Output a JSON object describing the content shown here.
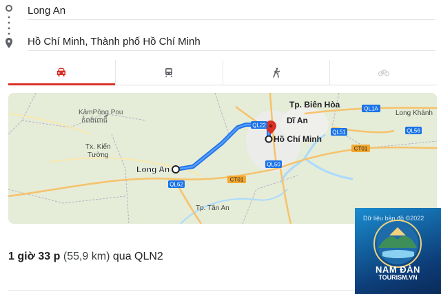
{
  "route": {
    "origin": "Long An",
    "destination": "Hồ Chí Minh, Thành phố Hồ Chí Minh",
    "origin_icon": "origin-circle-icon",
    "destination_icon": "destination-pin-icon"
  },
  "tabs": [
    {
      "name": "driving",
      "icon": "car-icon",
      "active": true
    },
    {
      "name": "transit",
      "icon": "train-icon",
      "active": false
    },
    {
      "name": "walking",
      "icon": "walking-icon",
      "active": false
    },
    {
      "name": "cycling",
      "icon": "bicycle-icon",
      "active": false
    }
  ],
  "map": {
    "labels": {
      "kampong": "KâmPông Pou",
      "kampong_khmer": "កំពង់ពោធិ៍",
      "tx_kien": "Tx. Kiến",
      "tuong": "Tường",
      "long_an": "Long An",
      "bien_hoa": "Tp. Biên Hòa",
      "di_an": "Dĩ An",
      "ho_chi_minh": "Hồ Chí Minh",
      "long_khanh": "Long Khánh",
      "tan_an": "Tp. Tân An"
    },
    "road_shields": {
      "ql1a": "QL1A",
      "ql22": "QL22",
      "ql51": "QL51",
      "ql56": "QL56",
      "ct01_a": "CT01",
      "ct01_b": "CT01",
      "ql50": "QL50",
      "ql62": "QL62"
    },
    "colors": {
      "route": "#1a73e8",
      "shield": "#1a73e8",
      "pin": "#d93025",
      "accent": "#d93025"
    }
  },
  "summary": {
    "duration": "1 giờ 33 p",
    "distance": "(55,9 km)",
    "via": "qua QLN2"
  },
  "watermark": {
    "date_text": "Dữ liệu bản đồ ©2022",
    "brand": "NAM ĐÀN",
    "site": "TOURISM.VN"
  }
}
